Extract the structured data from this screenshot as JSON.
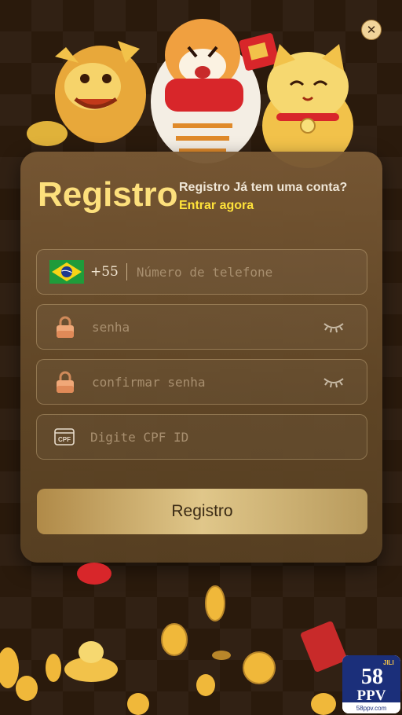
{
  "close": {
    "icon": "close-icon"
  },
  "form": {
    "title": "Registro",
    "subtitle": "Registro Já tem uma conta?",
    "login_link": "Entrar agora",
    "phone": {
      "dial_code": "+55",
      "placeholder": "Número de telefone",
      "flag": "brazil-flag-icon"
    },
    "password": {
      "placeholder": "senha",
      "icon": "lock-icon",
      "toggle_icon": "eye-closed-icon"
    },
    "confirm_password": {
      "placeholder": "confirmar senha",
      "icon": "lock-icon",
      "toggle_icon": "eye-closed-icon"
    },
    "cpf": {
      "placeholder": "Digite CPF ID",
      "icon_label": "CPF"
    },
    "submit_label": "Registro"
  },
  "logo": {
    "number": "58",
    "brand": "PPV",
    "tag": "JILI",
    "domain": "58ppv.com"
  },
  "colors": {
    "title": "#fde07c",
    "link": "#ffe23a",
    "button": "#e0c78a"
  }
}
